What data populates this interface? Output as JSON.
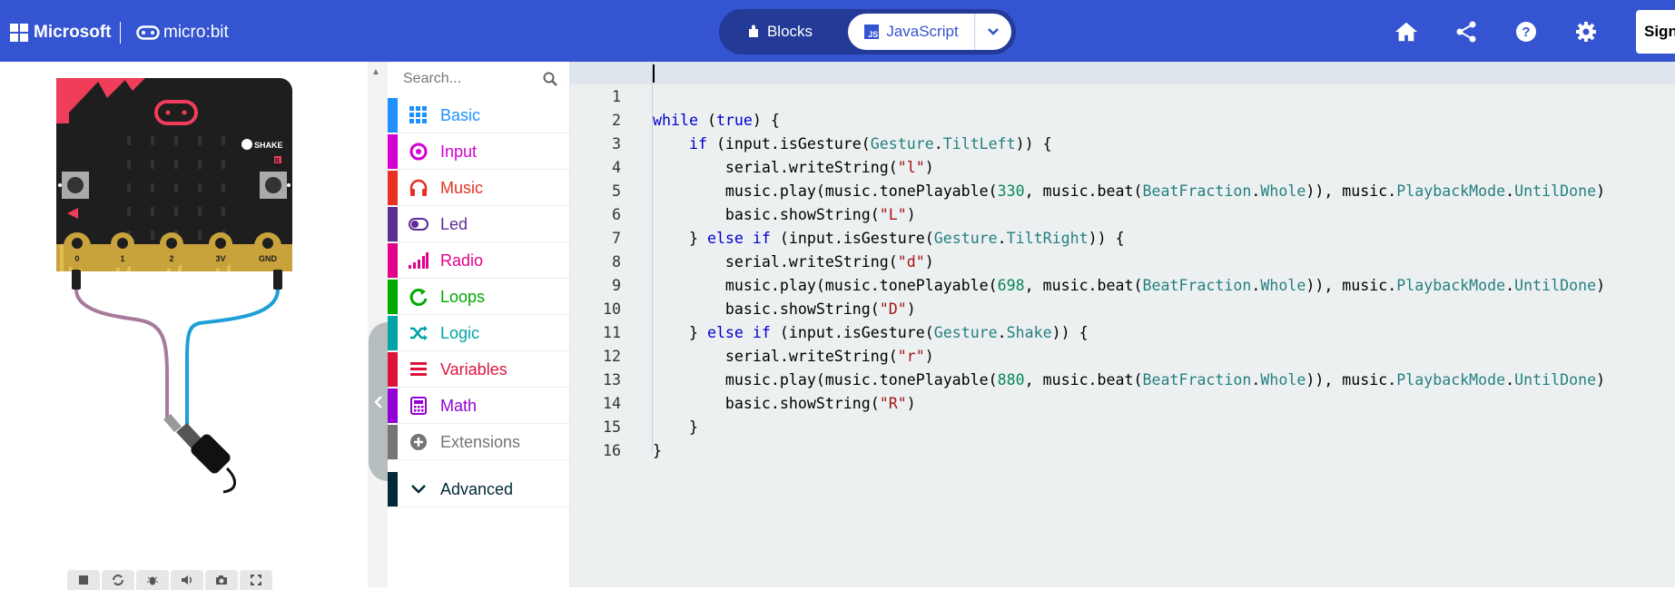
{
  "header": {
    "brand": "Microsoft",
    "product": "micro:bit",
    "tabs": {
      "blocks": "Blocks",
      "javascript": "JavaScript"
    },
    "js_badge": "JS",
    "sign_in": "Sign"
  },
  "simulator": {
    "shake_label": "SHAKE",
    "button_b": "B",
    "pins": [
      "0",
      "1",
      "2",
      "3V",
      "GND"
    ]
  },
  "toolbox": {
    "search_placeholder": "Search...",
    "categories": [
      {
        "label": "Basic",
        "color": "#1e90ff"
      },
      {
        "label": "Input",
        "color": "#d400d4"
      },
      {
        "label": "Music",
        "color": "#e63022"
      },
      {
        "label": "Led",
        "color": "#5c2d91"
      },
      {
        "label": "Radio",
        "color": "#e3008c"
      },
      {
        "label": "Loops",
        "color": "#00aa00"
      },
      {
        "label": "Logic",
        "color": "#00a4a6"
      },
      {
        "label": "Variables",
        "color": "#dc143c"
      },
      {
        "label": "Math",
        "color": "#9400d3"
      },
      {
        "label": "Extensions",
        "color": "#757575"
      },
      {
        "label": "Advanced",
        "color": "#002938"
      }
    ]
  },
  "editor": {
    "line_numbers": [
      "1",
      "2",
      "3",
      "4",
      "5",
      "6",
      "7",
      "8",
      "9",
      "10",
      "11",
      "12",
      "13",
      "14",
      "15",
      "16"
    ],
    "lines": [
      "while (true) {",
      "    if (input.isGesture(Gesture.TiltLeft)) {",
      "        serial.writeString(\"l\")",
      "        music.play(music.tonePlayable(330, music.beat(BeatFraction.Whole)), music.PlaybackMode.UntilDone)",
      "        basic.showString(\"L\")",
      "    } else if (input.isGesture(Gesture.TiltRight)) {",
      "        serial.writeString(\"d\")",
      "        music.play(music.tonePlayable(698, music.beat(BeatFraction.Whole)), music.PlaybackMode.UntilDone)",
      "        basic.showString(\"D\")",
      "    } else if (input.isGesture(Gesture.Shake)) {",
      "        serial.writeString(\"r\")",
      "        music.play(music.tonePlayable(880, music.beat(BeatFraction.Whole)), music.PlaybackMode.UntilDone)",
      "        basic.showString(\"R\")",
      "    }",
      "}",
      ""
    ]
  },
  "colors": {
    "header_bg": "#3454d1",
    "switch_bg": "#243a97",
    "editor_bg": "#ecf0f1"
  }
}
